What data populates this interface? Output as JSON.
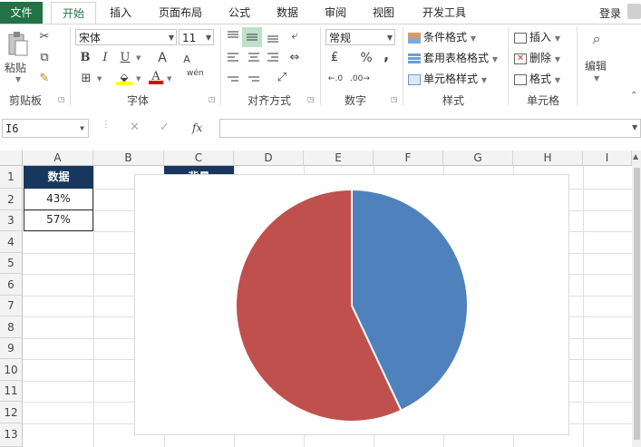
{
  "tabs": {
    "file": "文件",
    "items": [
      "开始",
      "插入",
      "页面布局",
      "公式",
      "数据",
      "审阅",
      "视图",
      "开发工具"
    ],
    "active_index": 0,
    "login": "登录"
  },
  "ribbon": {
    "clipboard": {
      "paste": "粘贴",
      "label": "剪贴板"
    },
    "font": {
      "name": "宋体",
      "size": "11",
      "label": "字体",
      "bold": "B",
      "italic": "I",
      "underline": "U",
      "grow": "A",
      "shrink": "A",
      "color_letter": "A",
      "phonetic": "wén"
    },
    "alignment": {
      "label": "对齐方式"
    },
    "number": {
      "format": "常规",
      "label": "数字",
      "percent": "%",
      "comma": ","
    },
    "styles": {
      "conditional": "条件格式",
      "table_format": "套用表格格式",
      "cell_styles": "单元格样式",
      "label": "样式"
    },
    "cells": {
      "insert": "插入",
      "delete": "删除",
      "format": "格式",
      "label": "单元格"
    },
    "editing": {
      "label": "编辑"
    }
  },
  "formula_bar": {
    "name_box": "I6",
    "fx": "fx",
    "value": ""
  },
  "columns": [
    "A",
    "B",
    "C",
    "D",
    "E",
    "F",
    "G",
    "H",
    "I"
  ],
  "rows": [
    "1",
    "2",
    "3",
    "4",
    "5",
    "6",
    "7",
    "8",
    "9",
    "10",
    "11",
    "12",
    "13"
  ],
  "cells": {
    "A1": "数据",
    "A2": "43%",
    "A3": "57%",
    "C1": "背景"
  },
  "chart_data": {
    "type": "pie",
    "title": "",
    "categories": [
      "43%",
      "57%"
    ],
    "values": [
      43,
      57
    ],
    "colors": [
      "#4f81bd",
      "#c0504d"
    ]
  },
  "colors": {
    "excel_green": "#217346",
    "header_fill": "#17375e"
  }
}
